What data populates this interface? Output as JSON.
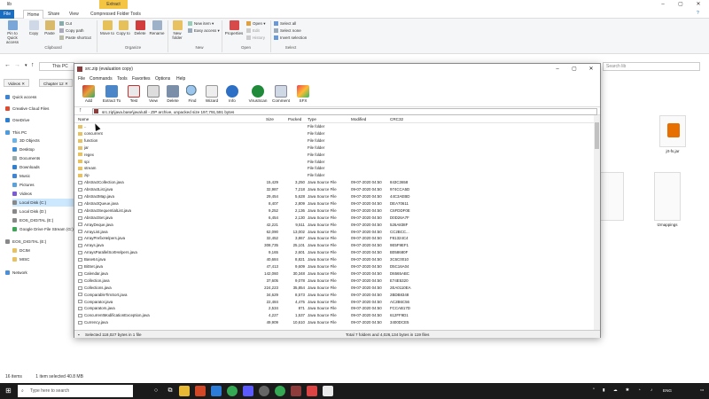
{
  "explorer": {
    "title": "lib",
    "extract_tab": "Extract",
    "ribbon_tabs": [
      "File",
      "Home",
      "Share",
      "View",
      "Compressed Folder Tools"
    ],
    "ribbon": {
      "pin": "Pin to Quick access",
      "copy": "Copy",
      "paste": "Paste",
      "cut": "Cut",
      "copy_path": "Copy path",
      "paste_shortcut": "Paste shortcut",
      "move_to": "Move to",
      "copy_to": "Copy to",
      "delete": "Delete",
      "rename": "Rename",
      "new_folder": "New folder",
      "new_item": "New item",
      "easy_access": "Easy access",
      "properties": "Properties",
      "open": "Open",
      "edit": "Edit",
      "history": "History",
      "select_all": "Select all",
      "select_none": "Select none",
      "invert_selection": "Invert selection",
      "groups": {
        "clipboard": "Clipboard",
        "organize": "Organize",
        "new": "New",
        "open": "Open",
        "select": "Select"
      }
    },
    "address": "This PC",
    "search_placeholder": "Search lib",
    "tabs": [
      "Videos",
      "Chapter 12"
    ],
    "nav": {
      "quick_access": "Quick access",
      "creative_cloud": "Creative Cloud Files",
      "onedrive": "OneDrive",
      "this_pc": "This PC",
      "items": [
        "3D Objects",
        "Desktop",
        "Documents",
        "Downloads",
        "Music",
        "Pictures",
        "Videos",
        "Local Disk (C:)",
        "Local Disk (D:)",
        "EOS_DIGITAL (E:)",
        "Google Drive File Stream (G:)"
      ],
      "eos": "EOS_DIGITAL (E:)",
      "eos_items": [
        "DCIM",
        "MISC"
      ],
      "network": "Network"
    },
    "right_files": [
      {
        "name": "jrt-fs.jar"
      },
      {
        "name": ""
      },
      {
        "name": "tzmappings"
      }
    ],
    "status": {
      "items": "16 items",
      "selected": "1 item selected  40.8 MB"
    }
  },
  "zip": {
    "title": "src.zip (evaluation copy)",
    "menu": [
      "File",
      "Commands",
      "Tools",
      "Favorites",
      "Options",
      "Help"
    ],
    "tools": [
      "Add",
      "Extract To",
      "Test",
      "View",
      "Delete",
      "Find",
      "Wizard",
      "Info",
      "VirusScan",
      "Comment",
      "SFX"
    ],
    "path": "src.zip\\java.base\\java\\util - ZIP archive, unpacked size 197,791,591 bytes",
    "columns": [
      "Name",
      "Size",
      "Packed",
      "Type",
      "Modified",
      "CRC32"
    ],
    "rows": [
      {
        "name": "..",
        "size": "",
        "packed": "",
        "type": "File folder",
        "modified": "",
        "crc": "",
        "folder": true
      },
      {
        "name": "concurrent",
        "size": "",
        "packed": "",
        "type": "File folder",
        "modified": "",
        "crc": "",
        "folder": true
      },
      {
        "name": "function",
        "size": "",
        "packed": "",
        "type": "File folder",
        "modified": "",
        "crc": "",
        "folder": true
      },
      {
        "name": "jar",
        "size": "",
        "packed": "",
        "type": "File folder",
        "modified": "",
        "crc": "",
        "folder": true
      },
      {
        "name": "regex",
        "size": "",
        "packed": "",
        "type": "File folder",
        "modified": "",
        "crc": "",
        "folder": true
      },
      {
        "name": "spi",
        "size": "",
        "packed": "",
        "type": "File folder",
        "modified": "",
        "crc": "",
        "folder": true
      },
      {
        "name": "stream",
        "size": "",
        "packed": "",
        "type": "File folder",
        "modified": "",
        "crc": "",
        "folder": true
      },
      {
        "name": "zip",
        "size": "",
        "packed": "",
        "type": "File folder",
        "modified": "",
        "crc": "",
        "folder": true
      },
      {
        "name": "AbstractCollection.java",
        "size": "15,429",
        "packed": "3,250",
        "type": "Java Source File",
        "modified": "09-07-2020 04:50",
        "crc": "843C3658"
      },
      {
        "name": "AbstractList.java",
        "size": "32,987",
        "packed": "7,218",
        "type": "Java Source File",
        "modified": "09-07-2020 04:50",
        "crc": "974CCA5D"
      },
      {
        "name": "AbstractMap.java",
        "size": "29,454",
        "packed": "5,628",
        "type": "Java Source File",
        "modified": "09-07-2020 04:50",
        "crc": "44C3AEBD"
      },
      {
        "name": "AbstractQueue.java",
        "size": "8,407",
        "packed": "2,809",
        "type": "Java Source File",
        "modified": "09-07-2020 04:50",
        "crc": "DEA70611"
      },
      {
        "name": "AbstractSequentialList.java",
        "size": "9,252",
        "packed": "2,136",
        "type": "Java Source File",
        "modified": "09-07-2020 04:50",
        "crc": "C6FDDF0E"
      },
      {
        "name": "AbstractSet.java",
        "size": "6,454",
        "packed": "2,130",
        "type": "Java Source File",
        "modified": "09-07-2020 04:50",
        "crc": "D0D26A7F"
      },
      {
        "name": "ArrayDeque.java",
        "size": "42,221",
        "packed": "9,511",
        "type": "Java Source File",
        "modified": "09-07-2020 04:50",
        "crc": "526A838F"
      },
      {
        "name": "ArrayList.java",
        "size": "62,090",
        "packed": "13,002",
        "type": "Java Source File",
        "modified": "09-07-2020 04:50",
        "crc": "CC2BCC..."
      },
      {
        "name": "ArrayPrefixHelpers.java",
        "size": "32,452",
        "packed": "3,867",
        "type": "Java Source File",
        "modified": "09-07-2020 04:50",
        "crc": "F81324C4"
      },
      {
        "name": "Arrays.java",
        "size": "308,735",
        "packed": "25,101",
        "type": "Java Source File",
        "modified": "09-07-2020 04:50",
        "crc": "9E5F9EF1"
      },
      {
        "name": "ArraysParallelSortHelpers.java",
        "size": "9,165",
        "packed": "2,601",
        "type": "Java Source File",
        "modified": "09-07-2020 04:50",
        "crc": "B058680F"
      },
      {
        "name": "Base64.java",
        "size": "40,684",
        "packed": "8,821",
        "type": "Java Source File",
        "modified": "09-07-2020 04:50",
        "crc": "3C6C0010"
      },
      {
        "name": "BitSet.java",
        "size": "47,413",
        "packed": "9,609",
        "type": "Java Source File",
        "modified": "09-07-2020 04:50",
        "crc": "D5C16A04"
      },
      {
        "name": "Calendar.java",
        "size": "142,060",
        "packed": "30,348",
        "type": "Java Source File",
        "modified": "09-07-2020 04:50",
        "crc": "D6565ABC"
      },
      {
        "name": "Collection.java",
        "size": "37,605",
        "packed": "9,078",
        "type": "Java Source File",
        "modified": "09-07-2020 04:50",
        "crc": "E74E5320"
      },
      {
        "name": "Collections.java",
        "size": "224,223",
        "packed": "35,854",
        "type": "Java Source File",
        "modified": "09-07-2020 04:50",
        "crc": "2EA0110EA"
      },
      {
        "name": "ComparableTimSort.java",
        "size": "34,629",
        "packed": "8,573",
        "type": "Java Source File",
        "modified": "09-07-2020 04:50",
        "crc": "2BDB8348"
      },
      {
        "name": "Comparator.java",
        "size": "22,484",
        "packed": "4,475",
        "type": "Java Source File",
        "modified": "09-07-2020 04:50",
        "crc": "AC2B6C56"
      },
      {
        "name": "Comparators.java",
        "size": "2,534",
        "packed": "871",
        "type": "Java Source File",
        "modified": "09-07-2020 04:50",
        "crc": "FCCAB17D"
      },
      {
        "name": "ConcurrentModificationException.java",
        "size": "4,227",
        "packed": "1,537",
        "type": "Java Source File",
        "modified": "09-07-2020 04:50",
        "crc": "612FF9D1"
      },
      {
        "name": "Currency.java",
        "size": "49,909",
        "packed": "10,610",
        "type": "Java Source File",
        "modified": "09-07-2020 04:50",
        "crc": "3400DCE5"
      }
    ],
    "status_left": "Selected 118,027 bytes in 1 file",
    "status_right": "Total 7 folders and 4,026,134 bytes in 119 files"
  },
  "taskbar": {
    "search_placeholder": "Type here to search",
    "lang": "ENG",
    "colors": {
      "bg": "#1b1b1b",
      "accent": "#1a6ec1"
    }
  }
}
